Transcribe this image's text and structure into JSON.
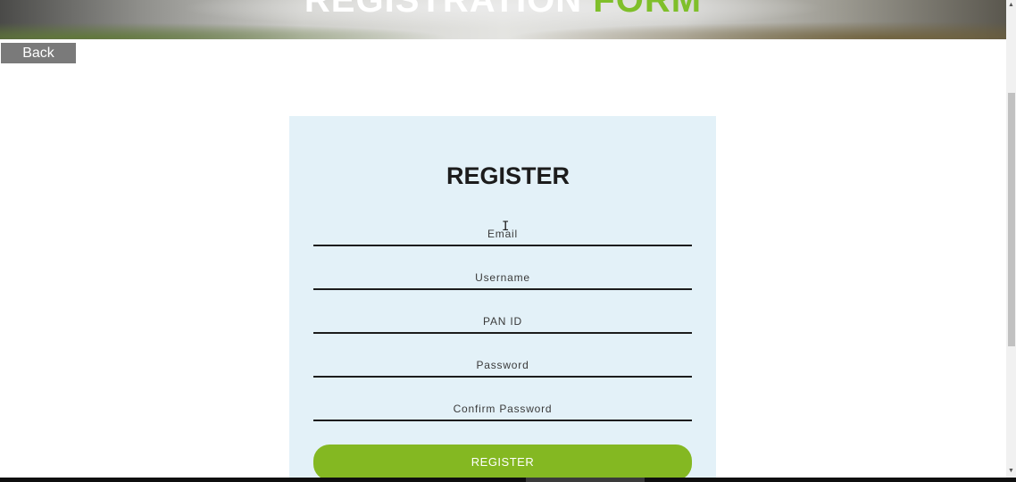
{
  "banner": {
    "title_main": "REGISTRATION ",
    "title_accent": "FORM"
  },
  "nav": {
    "back_label": "Back"
  },
  "form": {
    "heading": "REGISTER",
    "fields": [
      {
        "placeholder": "Email",
        "value": ""
      },
      {
        "placeholder": "Username",
        "value": ""
      },
      {
        "placeholder": "PAN ID",
        "value": ""
      },
      {
        "placeholder": "Password",
        "value": ""
      },
      {
        "placeholder": "Confirm Password",
        "value": ""
      }
    ],
    "submit_label": "REGISTER"
  },
  "colors": {
    "accent_green": "#84b822",
    "card_bg": "#e3f1f8",
    "back_button_bg": "#7a7a7a"
  },
  "icons": {
    "text_cursor": "I-beam",
    "scroll_up": "▲",
    "scroll_down": "▼"
  }
}
